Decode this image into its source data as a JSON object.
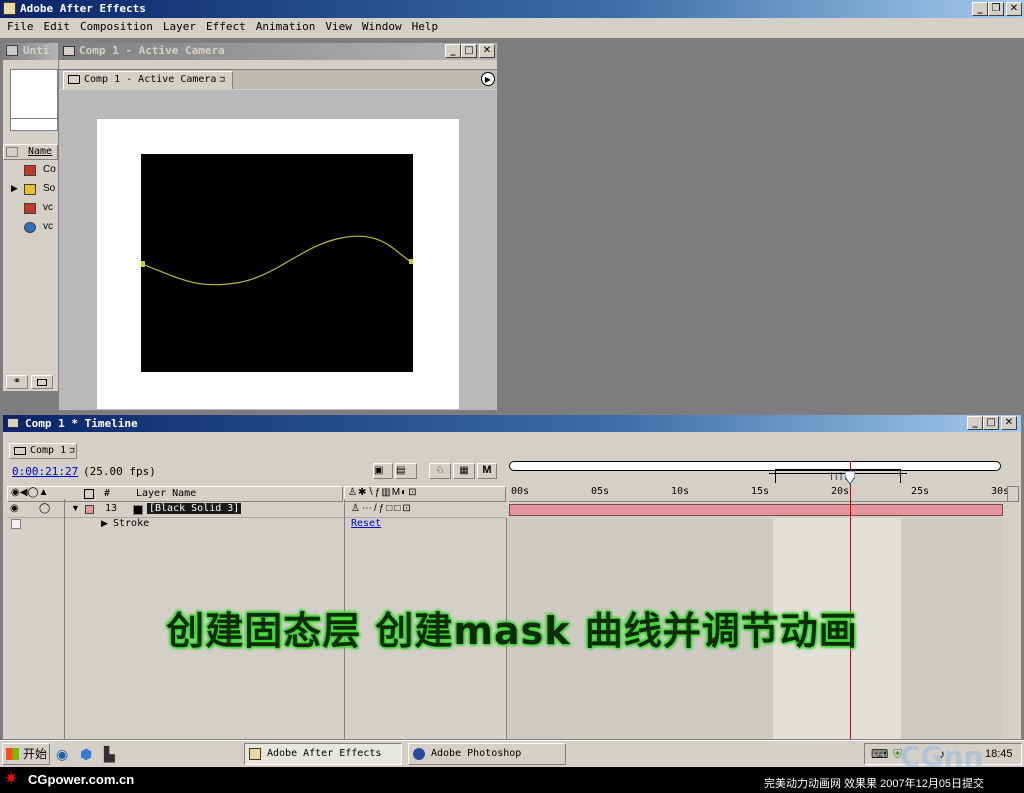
{
  "app": {
    "title": "Adobe After Effects"
  },
  "menu": [
    "File",
    "Edit",
    "Composition",
    "Layer",
    "Effect",
    "Animation",
    "View",
    "Window",
    "Help"
  ],
  "project": {
    "title": "Unti",
    "column_name": "Name",
    "items": [
      {
        "icon": "composition-icon",
        "label": "Co"
      },
      {
        "icon": "folder-icon",
        "label": "So"
      },
      {
        "icon": "composition-icon",
        "label": "vc"
      },
      {
        "icon": "quicktime-icon",
        "label": "vc"
      }
    ]
  },
  "comp_window": {
    "title": "Comp 1 - Active Camera",
    "tab": "Comp 1 - Active Camera"
  },
  "timeline": {
    "title": "Comp 1 * Timeline",
    "tab": "Comp 1",
    "timecode": "0:00:21:27",
    "fps": "(25.00 fps)",
    "columns": {
      "number": "#",
      "layer_name": "Layer Name"
    },
    "ruler": [
      "00s",
      "05s",
      "10s",
      "15s",
      "20s",
      "25s",
      "30s"
    ],
    "layer": {
      "number": "13",
      "name": "[Black Solid 3]"
    },
    "sub_layer": {
      "name": "Stroke",
      "value": "Reset"
    },
    "playhead_seconds": 21.08,
    "duration_seconds": 30
  },
  "caption": "创建固态层 创建mask 曲线并调节动画",
  "taskbar": {
    "start": "开始",
    "tasks": [
      "Adobe After Effects",
      "Adobe Photoshop"
    ],
    "clock": "18:45"
  },
  "watermark": {
    "site": "CGpower.com.cn",
    "footer": "完美动力动画网 效果果 2007年12月05日提交",
    "logo": "CGnn"
  },
  "colors": {
    "accent_title": "#0a246a",
    "playhead": "#d00000",
    "caption_text": "#0e2a06",
    "caption_glow": "#3ad630",
    "mask_path": "#b9b93a"
  }
}
